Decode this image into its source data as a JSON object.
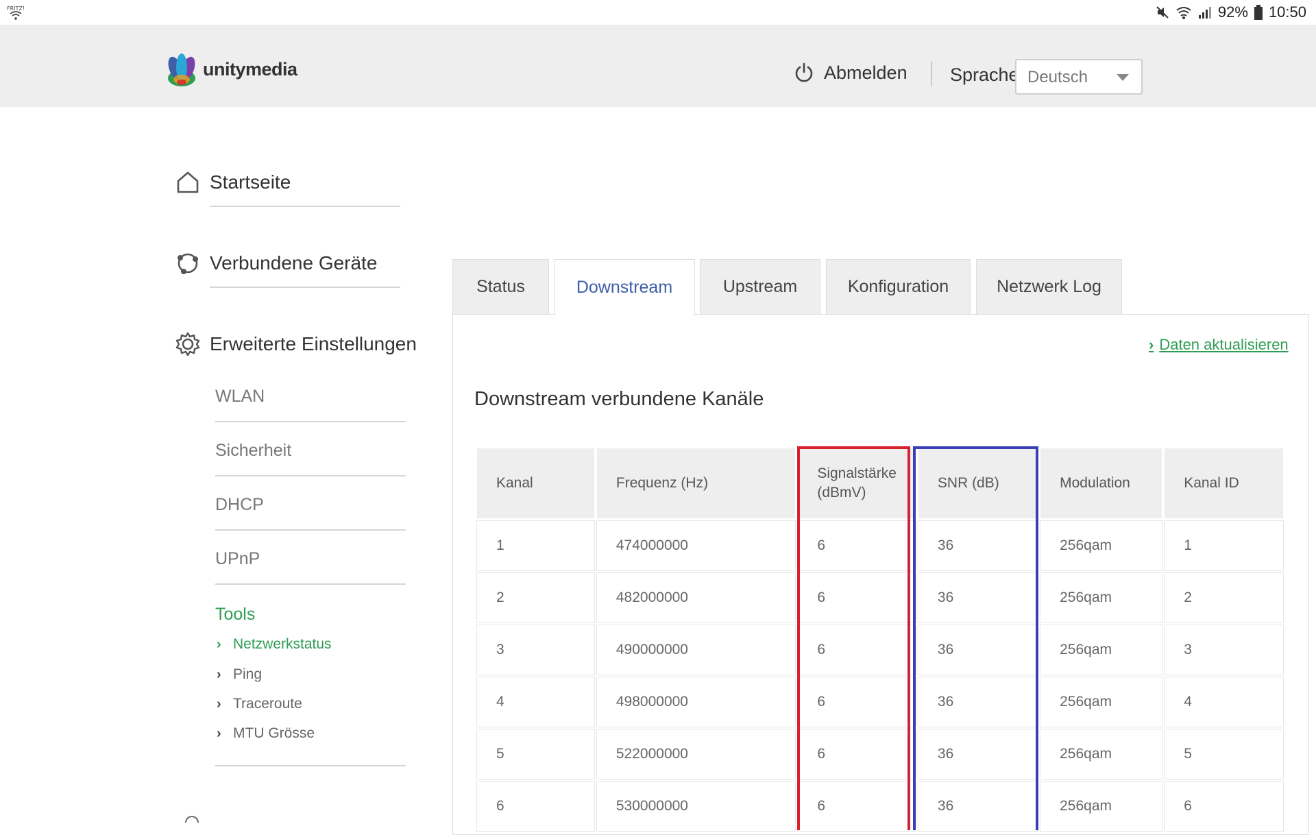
{
  "statusbar": {
    "battery": "92%",
    "time": "10:50",
    "left_icon": "wifi-notification-icon",
    "icons": [
      "mute-icon",
      "wifi-icon",
      "signal-icon",
      "battery-icon"
    ]
  },
  "header": {
    "logo_text": "unitymedia",
    "logout_label": "Abmelden",
    "language_label": "Sprache",
    "language_value": "Deutsch"
  },
  "sidebar": {
    "main": [
      {
        "label": "Startseite",
        "icon": "home-icon"
      },
      {
        "label": "Verbundene Geräte",
        "icon": "devices-icon"
      },
      {
        "label": "Erweiterte Einstellungen",
        "icon": "gear-icon"
      }
    ],
    "sub": [
      "WLAN",
      "Sicherheit",
      "DHCP",
      "UPnP"
    ],
    "tools_label": "Tools",
    "tools": [
      "Netzwerkstatus",
      "Ping",
      "Traceroute",
      "MTU Grösse"
    ],
    "active_tool": "Netzwerkstatus"
  },
  "tabs": [
    "Status",
    "Downstream",
    "Upstream",
    "Konfiguration",
    "Netzwerk Log"
  ],
  "active_tab": "Downstream",
  "content": {
    "refresh_link": "Daten aktualisieren",
    "section_title": "Downstream verbundene Kanäle"
  },
  "table": {
    "headers": [
      "Kanal",
      "Frequenz (Hz)",
      "Signalstärke (dBmV)",
      "SNR (dB)",
      "Modulation",
      "Kanal ID"
    ],
    "rows": [
      [
        "1",
        "474000000",
        "6",
        "36",
        "256qam",
        "1"
      ],
      [
        "2",
        "482000000",
        "6",
        "36",
        "256qam",
        "2"
      ],
      [
        "3",
        "490000000",
        "6",
        "36",
        "256qam",
        "3"
      ],
      [
        "4",
        "498000000",
        "6",
        "36",
        "256qam",
        "4"
      ],
      [
        "5",
        "522000000",
        "6",
        "36",
        "256qam",
        "5"
      ],
      [
        "6",
        "530000000",
        "6",
        "36",
        "256qam",
        "6"
      ]
    ]
  },
  "colors": {
    "accent_green": "#2e9d52",
    "active_tab_blue": "#3f5ea8",
    "highlight_red": "#d9202f",
    "highlight_blue": "#3a3fb8"
  }
}
